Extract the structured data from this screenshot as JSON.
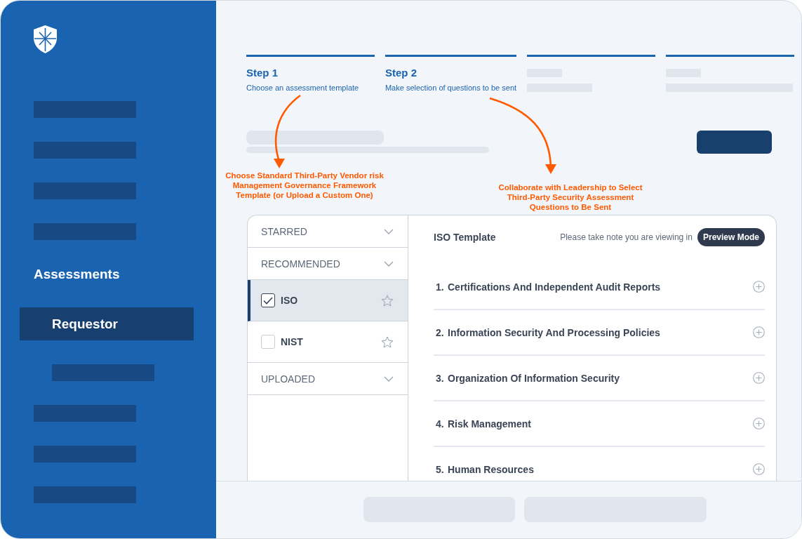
{
  "sidebar": {
    "items": [
      {
        "kind": "placeholder"
      },
      {
        "kind": "placeholder"
      },
      {
        "kind": "placeholder"
      },
      {
        "kind": "placeholder"
      },
      {
        "kind": "section",
        "label": "Assessments"
      },
      {
        "kind": "item",
        "label": "Requestor",
        "selected": true
      },
      {
        "kind": "subplaceholder"
      },
      {
        "kind": "placeholder"
      },
      {
        "kind": "placeholder"
      },
      {
        "kind": "placeholder"
      }
    ]
  },
  "steps": [
    {
      "kind": "labeled",
      "title": "Step 1",
      "subtitle": "Choose an assessment template"
    },
    {
      "kind": "labeled",
      "title": "Step 2",
      "subtitle": "Make selection of questions to be sent"
    },
    {
      "kind": "placeholder"
    },
    {
      "kind": "placeholder"
    }
  ],
  "annotations": [
    {
      "text": "Choose Standard Third-Party Vendor risk Management Governance Framework Template (or Upload a Custom One)"
    },
    {
      "text": "Collaborate with Leadership to Select Third-Party Security Assessment Questions to Be Sent"
    }
  ],
  "template_list": [
    {
      "kind": "group",
      "label": "STARRED"
    },
    {
      "kind": "group",
      "label": "RECOMMENDED"
    },
    {
      "kind": "template",
      "label": "ISO",
      "checked": true,
      "selected": true
    },
    {
      "kind": "template",
      "label": "NIST",
      "checked": false,
      "selected": false
    },
    {
      "kind": "group",
      "label": "UPLOADED"
    }
  ],
  "template_view": {
    "title": "ISO Template",
    "note": "Please take note you are viewing in",
    "badge": "Preview Mode",
    "sections": [
      {
        "number": "1.",
        "title": "Certifications And Independent Audit Reports"
      },
      {
        "number": "2.",
        "title": "Information Security And Processing Policies"
      },
      {
        "number": "3.",
        "title": "Organization Of Information Security"
      },
      {
        "number": "4.",
        "title": "Risk Management"
      },
      {
        "number": "5.",
        "title": "Human Resources"
      }
    ]
  }
}
